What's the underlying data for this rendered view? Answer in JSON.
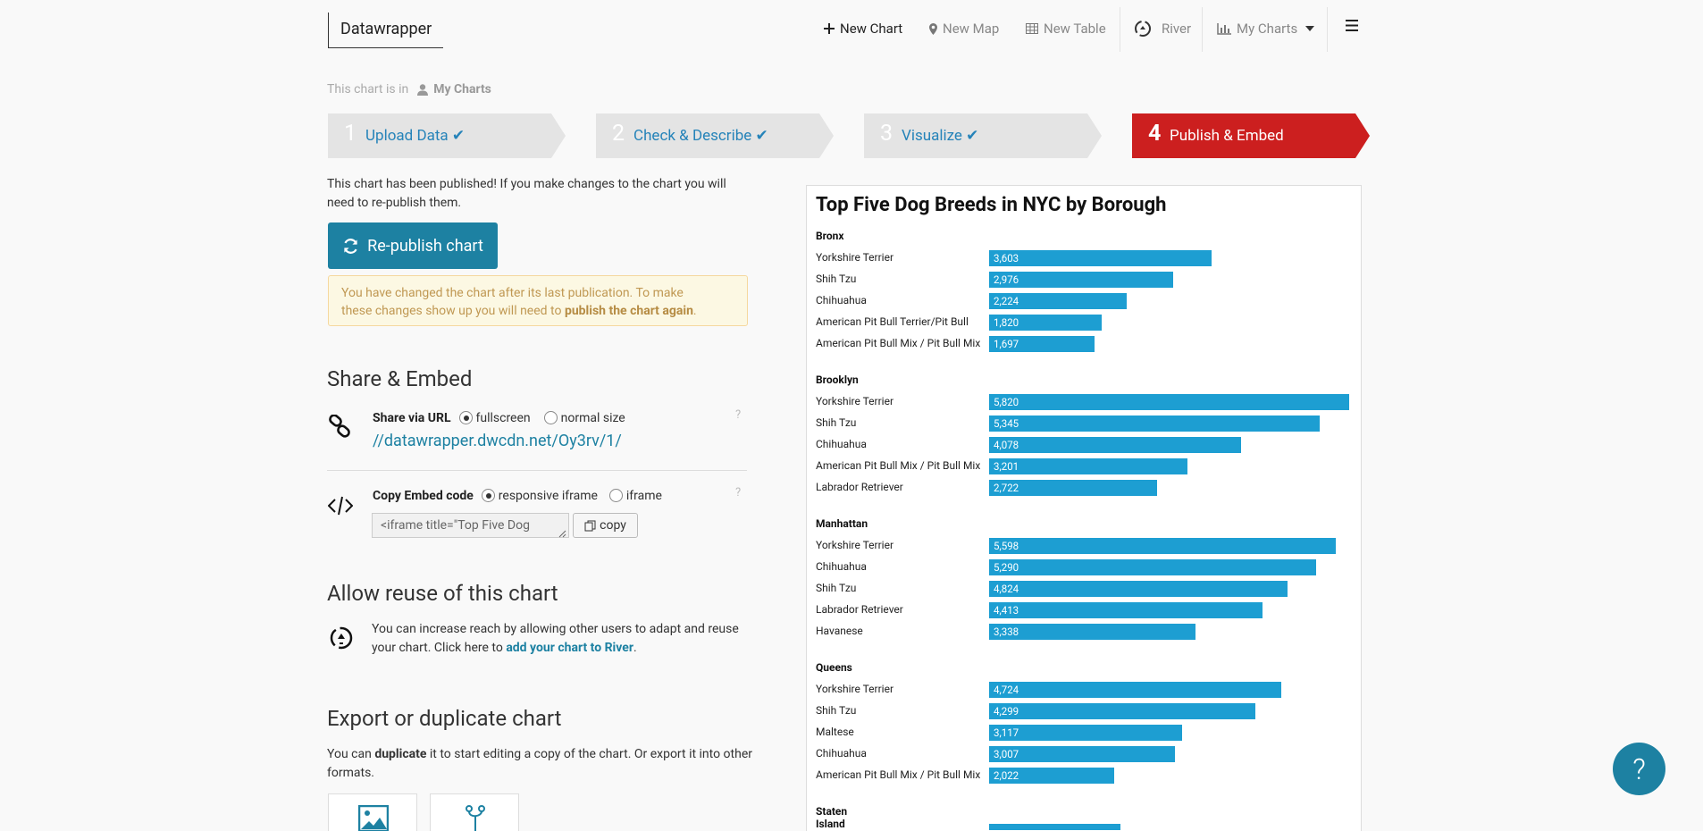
{
  "header": {
    "logo": "Datawrapper",
    "nav": {
      "new_chart": "New Chart",
      "new_map": "New Map",
      "new_table": "New Table",
      "river": "River",
      "my_charts": "My Charts"
    }
  },
  "breadcrumb": {
    "prefix": "This chart is in",
    "folder": "My Charts"
  },
  "steps": [
    {
      "num": "1",
      "label": "Upload Data",
      "done": true
    },
    {
      "num": "2",
      "label": "Check & Describe",
      "done": true
    },
    {
      "num": "3",
      "label": "Visualize",
      "done": true
    },
    {
      "num": "4",
      "label": "Publish & Embed",
      "active": true
    }
  ],
  "publish": {
    "published_text_1": "This chart has been published! If you make changes to the chart you will",
    "published_text_2": "need to re-publish them.",
    "republish_button": "Re-publish chart",
    "warning_1": "You have changed the chart after its last publication. To make",
    "warning_2_prefix": "these changes show up you will need to",
    "warning_2_bold": "publish the chart again",
    "warning_2_suffix": "."
  },
  "share": {
    "heading": "Share & Embed",
    "url_label": "Share via URL",
    "opt_fullscreen": "fullscreen",
    "opt_normal": "normal size",
    "url": "//datawrapper.dwcdn.net/Oy3rv/1/",
    "help": "?",
    "embed_label": "Copy Embed code",
    "opt_responsive": "responsive iframe",
    "opt_iframe": "iframe",
    "embed_code": "<iframe title=\"Top Five Dog",
    "copy_button": "copy"
  },
  "reuse": {
    "heading": "Allow reuse of this chart",
    "text_1": "You can increase reach by allowing other users to adapt and reuse",
    "text_2_prefix": "your chart. Click here to",
    "text_2_link": "add your chart to River",
    "text_2_suffix": "."
  },
  "export": {
    "heading": "Export or duplicate chart",
    "text_1_prefix": "You can",
    "text_1_bold": "duplicate",
    "text_1_suffix": "it to start editing a copy of the chart. Or export it into other",
    "text_2": "formats."
  },
  "help_button": "?",
  "colors": {
    "accent": "#1d81a2",
    "bar": "#1d9ed2",
    "active_step": "#cc1f1f"
  },
  "chart_data": {
    "type": "bar",
    "title": "Top Five Dog Breeds in NYC by Borough",
    "xlim": [
      0,
      5820
    ],
    "groups": [
      {
        "name": "Bronx",
        "rows": [
          {
            "label": "Yorkshire Terrier",
            "value": 3603,
            "display": "3,603"
          },
          {
            "label": "Shih Tzu",
            "value": 2976,
            "display": "2,976"
          },
          {
            "label": "Chihuahua",
            "value": 2224,
            "display": "2,224"
          },
          {
            "label": "American Pit Bull Terrier/Pit Bull",
            "value": 1820,
            "display": "1,820"
          },
          {
            "label": "American Pit Bull Mix / Pit Bull Mix",
            "value": 1697,
            "display": "1,697"
          }
        ]
      },
      {
        "name": "Brooklyn",
        "rows": [
          {
            "label": "Yorkshire Terrier",
            "value": 5820,
            "display": "5,820"
          },
          {
            "label": "Shih Tzu",
            "value": 5345,
            "display": "5,345"
          },
          {
            "label": "Chihuahua",
            "value": 4078,
            "display": "4,078"
          },
          {
            "label": "American Pit Bull Mix / Pit Bull Mix",
            "value": 3201,
            "display": "3,201"
          },
          {
            "label": "Labrador Retriever",
            "value": 2722,
            "display": "2,722"
          }
        ]
      },
      {
        "name": "Manhattan",
        "rows": [
          {
            "label": "Yorkshire Terrier",
            "value": 5598,
            "display": "5,598"
          },
          {
            "label": "Chihuahua",
            "value": 5290,
            "display": "5,290"
          },
          {
            "label": "Shih Tzu",
            "value": 4824,
            "display": "4,824"
          },
          {
            "label": "Labrador Retriever",
            "value": 4413,
            "display": "4,413"
          },
          {
            "label": "Havanese",
            "value": 3338,
            "display": "3,338"
          }
        ]
      },
      {
        "name": "Queens",
        "rows": [
          {
            "label": "Yorkshire Terrier",
            "value": 4724,
            "display": "4,724"
          },
          {
            "label": "Shih Tzu",
            "value": 4299,
            "display": "4,299"
          },
          {
            "label": "Maltese",
            "value": 3117,
            "display": "3,117"
          },
          {
            "label": "Chihuahua",
            "value": 3007,
            "display": "3,007"
          },
          {
            "label": "American Pit Bull Mix / Pit Bull Mix",
            "value": 2022,
            "display": "2,022"
          }
        ]
      },
      {
        "name": "Staten Island",
        "rows": []
      }
    ]
  }
}
